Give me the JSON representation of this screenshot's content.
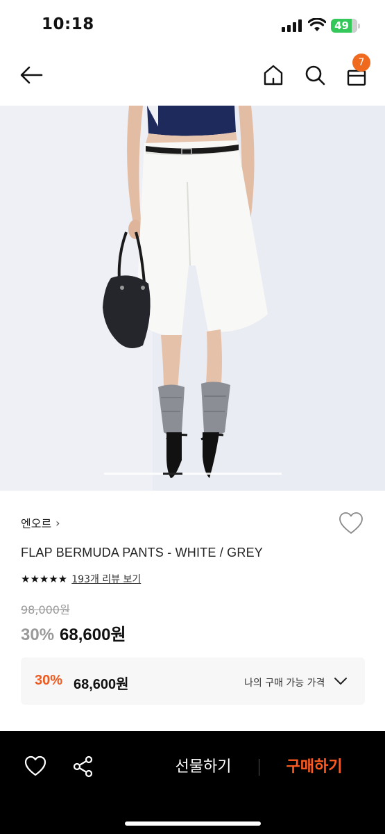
{
  "status_bar": {
    "time": "10:18",
    "battery": "49"
  },
  "nav": {
    "back_icon": "arrow-left-icon",
    "home_icon": "home-icon",
    "search_icon": "search-icon",
    "cart_icon": "shopping-bag-icon",
    "cart_count": "7"
  },
  "gallery": {
    "image_alt": "model wearing white bermuda pants",
    "slide_fraction": 0.33
  },
  "product": {
    "brand": "엔오르",
    "brand_chevron": "›",
    "name": "FLAP BERMUDA PANTS - WHITE / GREY",
    "stars": "★★★★★",
    "review_link": "193개 리뷰 보기",
    "original_price": "98,000원",
    "discount": "30%",
    "sale_price": "68,600원"
  },
  "my_price": {
    "discount": "30%",
    "price": "68,600원",
    "label": "나의 구매 가능 가격"
  },
  "bottom_bar": {
    "gift_label": "선물하기",
    "buy_label": "구매하기"
  },
  "colors": {
    "accent": "#ef5a1f",
    "badge": "#ef6a1f",
    "bottom_bar": "#000000"
  }
}
